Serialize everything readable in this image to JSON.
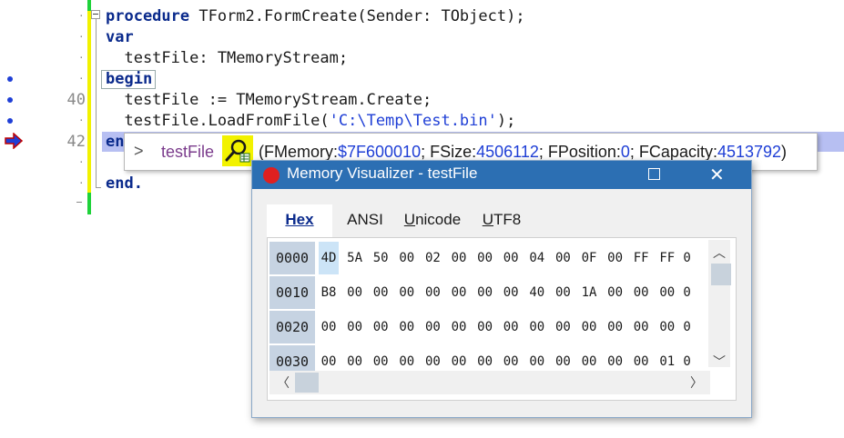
{
  "editor": {
    "line_numbers": [
      "40",
      "42"
    ],
    "code": {
      "l1_kw": "procedure",
      "l1_rest": " TForm2.FormCreate(Sender: TObject);",
      "l2_kw": "var",
      "l3": "  testFile: TMemoryStream;",
      "l4_kw": "begin",
      "l5": "  testFile := TMemoryStream.Create;",
      "l6_pre": "  testFile.LoadFromFile(",
      "l6_str": "'C:\\Temp\\Test.bin'",
      "l6_post": ");",
      "l7_kw": "en",
      "l8_kw": "end."
    },
    "colors": {
      "current_line": "#b7bff2",
      "modified_bar": "#f2f200",
      "saved_bar": "#1fd23a"
    }
  },
  "hint": {
    "chevron": ">",
    "name": "testFile",
    "icon": "visualizer-icon",
    "value": {
      "p1": "(FMemory:",
      "v1": "$7F600010",
      "p2": "; FSize:",
      "v2": "4506112",
      "p3": "; FPosition:",
      "v3": "0",
      "p4": "; FCapacity:",
      "v4": "4513792",
      "p5": ")"
    }
  },
  "visualizer": {
    "title": "Memory Visualizer - testFile",
    "tabs": [
      {
        "label": "Hex",
        "active": true
      },
      {
        "label": "ANSI",
        "active": false
      },
      {
        "label": "Unicode",
        "active": false
      },
      {
        "label": "UTF8",
        "active": false
      }
    ],
    "rows": [
      {
        "addr": "0000",
        "bytes": [
          "4D",
          "5A",
          "50",
          "00",
          "02",
          "00",
          "00",
          "00",
          "04",
          "00",
          "0F",
          "00",
          "FF",
          "FF",
          "0"
        ]
      },
      {
        "addr": "0010",
        "bytes": [
          "B8",
          "00",
          "00",
          "00",
          "00",
          "00",
          "00",
          "00",
          "40",
          "00",
          "1A",
          "00",
          "00",
          "00",
          "0"
        ]
      },
      {
        "addr": "0020",
        "bytes": [
          "00",
          "00",
          "00",
          "00",
          "00",
          "00",
          "00",
          "00",
          "00",
          "00",
          "00",
          "00",
          "00",
          "00",
          "0"
        ]
      },
      {
        "addr": "0030",
        "bytes": [
          "00",
          "00",
          "00",
          "00",
          "00",
          "00",
          "00",
          "00",
          "00",
          "00",
          "00",
          "00",
          "00",
          "01",
          "0"
        ]
      }
    ],
    "scroll": {
      "up": "^",
      "down": "v",
      "left": "<",
      "right": ">"
    }
  }
}
